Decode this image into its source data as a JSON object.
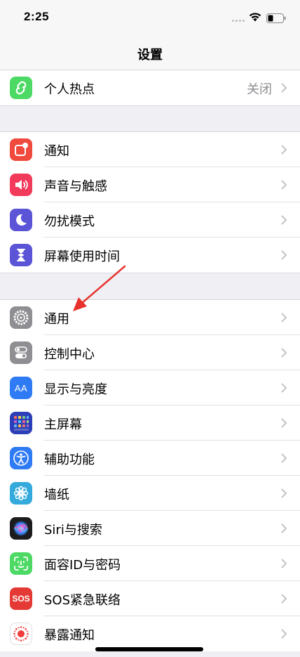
{
  "status": {
    "time": "2:25"
  },
  "nav": {
    "title": "设置"
  },
  "group1": [
    {
      "label": "个人热点",
      "value": "关闭",
      "color": "#4cd964",
      "icon": "hotspot-icon"
    }
  ],
  "group2": [
    {
      "label": "通知",
      "color": "#f04a3e",
      "icon": "notifications-icon"
    },
    {
      "label": "声音与触感",
      "color": "#f23a5a",
      "icon": "sound-icon"
    },
    {
      "label": "勿扰模式",
      "color": "#5b54d6",
      "icon": "moon-icon"
    },
    {
      "label": "屏幕使用时间",
      "color": "#5b54d6",
      "icon": "hourglass-icon"
    }
  ],
  "group3": [
    {
      "label": "通用",
      "color": "#8e8e93",
      "icon": "gear-icon"
    },
    {
      "label": "控制中心",
      "color": "#8e8e93",
      "icon": "toggles-icon"
    },
    {
      "label": "显示与亮度",
      "color": "#2f7bf5",
      "icon": "text-size-icon",
      "glyph": "AA"
    },
    {
      "label": "主屏幕",
      "color": "#2c3fb8",
      "icon": "home-screen-icon"
    },
    {
      "label": "辅助功能",
      "color": "#2f7bf5",
      "icon": "accessibility-icon"
    },
    {
      "label": "墙纸",
      "color": "#34aadc",
      "icon": "flower-icon"
    },
    {
      "label": "Siri与搜索",
      "color": "#222",
      "icon": "siri-icon"
    },
    {
      "label": "面容ID与密码",
      "color": "#4cd964",
      "icon": "face-id-icon"
    },
    {
      "label": "SOS紧急联络",
      "color": "#e53935",
      "icon": "sos-icon",
      "glyph": "SOS"
    },
    {
      "label": "暴露通知",
      "color": "#ffffff",
      "icon": "exposure-icon"
    }
  ]
}
